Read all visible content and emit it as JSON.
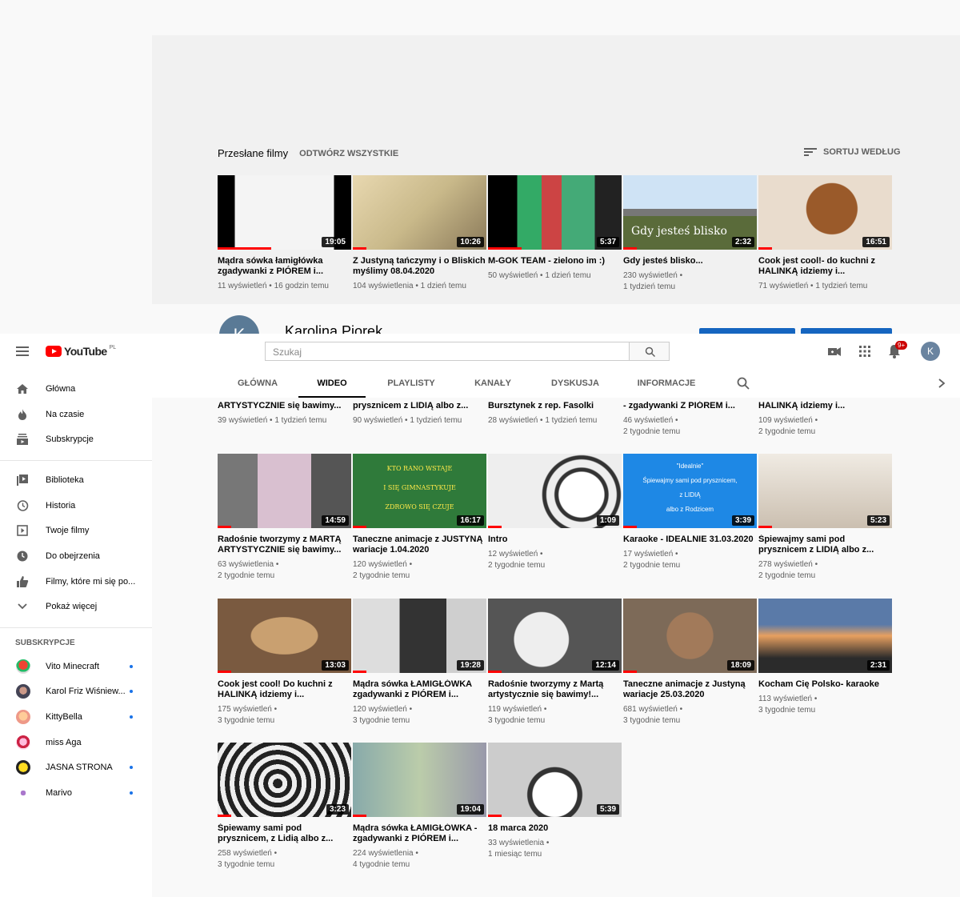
{
  "section": {
    "title": "Przesłane filmy",
    "play_all": "ODTWÓRZ WSZYSTKIE",
    "sort": "SORTUJ WEDŁUG"
  },
  "channel": {
    "name": "Karolina Piorek",
    "avatar_letter": "K"
  },
  "masthead": {
    "logo": "YouTube",
    "country": "PL",
    "search_placeholder": "Szukaj",
    "notif_count": "9+",
    "user_letter": "K"
  },
  "tabs": [
    "GŁÓWNA",
    "WIDEO",
    "PLAYLISTY",
    "KANAŁY",
    "DYSKUSJA",
    "INFORMACJE"
  ],
  "sidebar": {
    "main": [
      "Główna",
      "Na czasie",
      "Subskrypcje"
    ],
    "library": [
      "Biblioteka",
      "Historia",
      "Twoje filmy",
      "Do obejrzenia",
      "Filmy, które mi się po...",
      "Pokaż więcej"
    ],
    "subs_header": "SUBSKRYPCJE",
    "subs": [
      "Vito Minecraft",
      "Karol Friz Wiśniew...",
      "KittyBella",
      "miss Aga",
      "JASNA STRONA",
      "Marivo"
    ]
  },
  "row_top": [
    {
      "title": "Mądra sówka łamigłówka zgadywanki z PIÓREM i...",
      "views": "11 wyświetleń",
      "age": "16 godzin temu",
      "duration": "19:05",
      "progress": 0.4
    },
    {
      "title": "Z Justyną tańczymy i o Bliskich myślimy 08.04.2020",
      "views": "104 wyświetlenia",
      "age": "1 dzień temu",
      "duration": "10:26",
      "progress": 0.1
    },
    {
      "title": "M-GOK TEAM - zielono im :)",
      "views": "50 wyświetleń",
      "age": "1 dzień temu",
      "duration": "5:37",
      "progress": 0.25
    },
    {
      "title": "Gdy jesteś blisko...",
      "views": "230 wyświetleń",
      "age": "1 tydzień temu",
      "duration": "2:32",
      "progress": 0.1
    },
    {
      "title": "Cook jest cool!- do kuchni z HALINKĄ idziemy i...",
      "views": "71 wyświetleń",
      "age": "1 tydzień temu",
      "duration": "16:51",
      "progress": 0.1
    }
  ],
  "row_cut": [
    {
      "title": "ARTYSTYCZNIE się bawimy...",
      "views": "39 wyświetleń",
      "age": "1 tydzień temu"
    },
    {
      "title": "prysznicem z LIDIĄ albo z...",
      "views": "90 wyświetleń",
      "age": "1 tydzień temu"
    },
    {
      "title": "Bursztynek z rep. Fasolki",
      "views": "28 wyświetleń",
      "age": "1 tydzień temu"
    },
    {
      "title": "- zgadywanki Z PIÓREM i...",
      "views": "46 wyświetleń",
      "age": "2 tygodnie temu"
    },
    {
      "title": "HALINKĄ idziemy i...",
      "views": "109 wyświetleń",
      "age": "2 tygodnie temu"
    }
  ],
  "row_a": [
    {
      "title": "Radośnie tworzymy z MARTĄ ARTYSTYCZNIE się bawimy...",
      "views": "63 wyświetlenia",
      "age": "2 tygodnie temu",
      "duration": "14:59",
      "progress": 0.1
    },
    {
      "title": "Taneczne animacje z JUSTYNĄ wariacje 1.04.2020",
      "views": "120 wyświetleń",
      "age": "2 tygodnie temu",
      "duration": "16:17",
      "progress": 0.1,
      "thumb_text": [
        "KTO RANO WSTAJE",
        "I SIĘ GIMNASTYKUJE",
        "ZDROWO SIĘ CZUJE"
      ]
    },
    {
      "title": "Intro",
      "views": "12 wyświetleń",
      "age": "2 tygodnie temu",
      "duration": "1:09",
      "progress": 0.1
    },
    {
      "title": "Karaoke - IDEALNIE 31.03.2020",
      "views": "17 wyświetleń",
      "age": "2 tygodnie temu",
      "duration": "3:39",
      "progress": 0.1,
      "thumb_text": [
        "\"Idealnie\"",
        "Śpiewajmy sami pod prysznicem,",
        "z LIDIĄ",
        "albo z Rodzicem"
      ]
    },
    {
      "title": "Śpiewajmy sami pod prysznicem z LIDIĄ albo z...",
      "views": "278 wyświetleń",
      "age": "2 tygodnie temu",
      "duration": "5:23",
      "progress": 0.1
    }
  ],
  "row_b": [
    {
      "title": "Cook jest cool! Do kuchni z HALINKĄ idziemy i...",
      "views": "175 wyświetleń",
      "age": "3 tygodnie temu",
      "duration": "13:03",
      "progress": 0.1
    },
    {
      "title": "Mądra sówka ŁAMIGŁÓWKA zgadywanki z PIÓREM i...",
      "views": "120 wyświetleń",
      "age": "3 tygodnie temu",
      "duration": "19:28",
      "progress": 0.1
    },
    {
      "title": "Radośnie tworzymy z Martą artystycznie się bawimy!...",
      "views": "119 wyświetleń",
      "age": "3 tygodnie temu",
      "duration": "12:14",
      "progress": 0.1
    },
    {
      "title": "Taneczne animacje z Justyną wariacje 25.03.2020",
      "views": "681 wyświetleń",
      "age": "3 tygodnie temu",
      "duration": "18:09",
      "progress": 0.1
    },
    {
      "title": "Kocham Cię Polsko- karaoke",
      "views": "113 wyświetleń",
      "age": "3 tygodnie temu",
      "duration": "2:31",
      "progress": 0
    }
  ],
  "row_c": [
    {
      "title": "Śpiewamy sami pod prysznicem, z Lidią albo z...",
      "views": "258 wyświetleń",
      "age": "3 tygodnie temu",
      "duration": "3:23",
      "progress": 0.1
    },
    {
      "title": "Mądra sówka ŁAMIGŁÓWKA - zgadywanki z PIÓREM i...",
      "views": "224 wyświetlenia",
      "age": "4 tygodnie temu",
      "duration": "19:04",
      "progress": 0.1
    },
    {
      "title": "18 marca 2020",
      "views": "33 wyświetlenia",
      "age": "1 miesiąc temu",
      "duration": "5:39",
      "progress": 0.1
    }
  ],
  "thumb_overlay": {
    "gdy": "Gdy jesteś blisko"
  },
  "colors": {
    "accent": "#ff0000",
    "link_blue": "#1565c0",
    "text": "#030303",
    "meta": "#606060"
  }
}
